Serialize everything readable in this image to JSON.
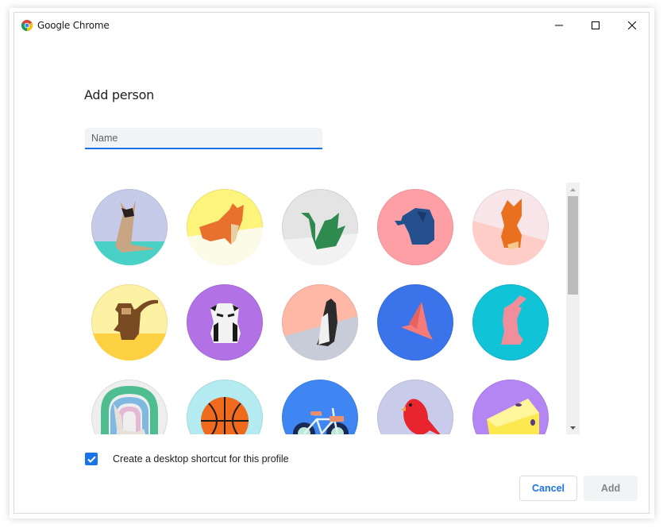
{
  "window": {
    "title": "Google Chrome",
    "controls": {
      "minimize": "minimize",
      "maximize": "maximize",
      "close": "close"
    }
  },
  "dialog": {
    "heading": "Add person",
    "name_input": {
      "value": "",
      "placeholder": "Name"
    },
    "avatars": [
      {
        "name": "origami-cat",
        "label": "Cat",
        "bg": "#c5cbe9",
        "accent": "#48d1c4",
        "figure": "#c8a583"
      },
      {
        "name": "origami-corgi",
        "label": "Corgi",
        "bg": "#fdf47c",
        "accent": "#fbfbe8",
        "figure": "#e8712d"
      },
      {
        "name": "origami-dragon",
        "label": "Dragon",
        "bg": "#e4e4e4",
        "accent": "#f2f2f2",
        "figure": "#2f8a4f"
      },
      {
        "name": "origami-elephant",
        "label": "Elephant",
        "bg": "#fe9fa6",
        "accent": "#fe9fa6",
        "figure": "#24508e"
      },
      {
        "name": "origami-fox",
        "label": "Fox",
        "bg": "#f9e6ea",
        "accent": "#fecdc7",
        "figure": "#e8701f"
      },
      {
        "name": "origami-monkey",
        "label": "Monkey",
        "bg": "#fdf1a3",
        "accent": "#fdd142",
        "figure": "#7a4a22"
      },
      {
        "name": "origami-panda",
        "label": "Panda",
        "bg": "#b272e5",
        "accent": "#b272e5",
        "figure": "#f2f2f2"
      },
      {
        "name": "origami-penguin",
        "label": "Penguin",
        "bg": "#ffb8a6",
        "accent": "#c8ccd8",
        "figure": "#2b2b2b"
      },
      {
        "name": "origami-butterfly",
        "label": "Butterfly",
        "bg": "#3a73ea",
        "accent": "#3a73ea",
        "figure": "#f47b78"
      },
      {
        "name": "origami-rabbit",
        "label": "Rabbit",
        "bg": "#11c3d6",
        "accent": "#11c3d6",
        "figure": "#f08f9b"
      },
      {
        "name": "origami-unicorn",
        "label": "Unicorn",
        "bg": "#eeeeee",
        "accent": "#7fb8e1",
        "figure": "#e6e1d8"
      },
      {
        "name": "illustration-basketball",
        "label": "Basketball",
        "bg": "#b3ebf0",
        "accent": "#b3ebf0",
        "figure": "#f06a1d"
      },
      {
        "name": "illustration-bicycle",
        "label": "Bicycle",
        "bg": "#3f86f3",
        "accent": "#3f86f3",
        "figure": "#e98f6b"
      },
      {
        "name": "illustration-cardinal",
        "label": "Cardinal",
        "bg": "#c8cbea",
        "accent": "#c8cbea",
        "figure": "#e8242e"
      },
      {
        "name": "illustration-cheese",
        "label": "Cheese",
        "bg": "#b486f4",
        "accent": "#9c6be8",
        "figure": "#fce94f"
      }
    ],
    "scroll_position": 0,
    "shortcut_checkbox": {
      "label": "Create a desktop shortcut for this profile",
      "checked": true
    },
    "buttons": {
      "cancel": "Cancel",
      "add": "Add"
    }
  },
  "colors": {
    "accent": "#1a73e8",
    "disabled_bg": "#f1f3f4",
    "disabled_text": "#80868b"
  }
}
